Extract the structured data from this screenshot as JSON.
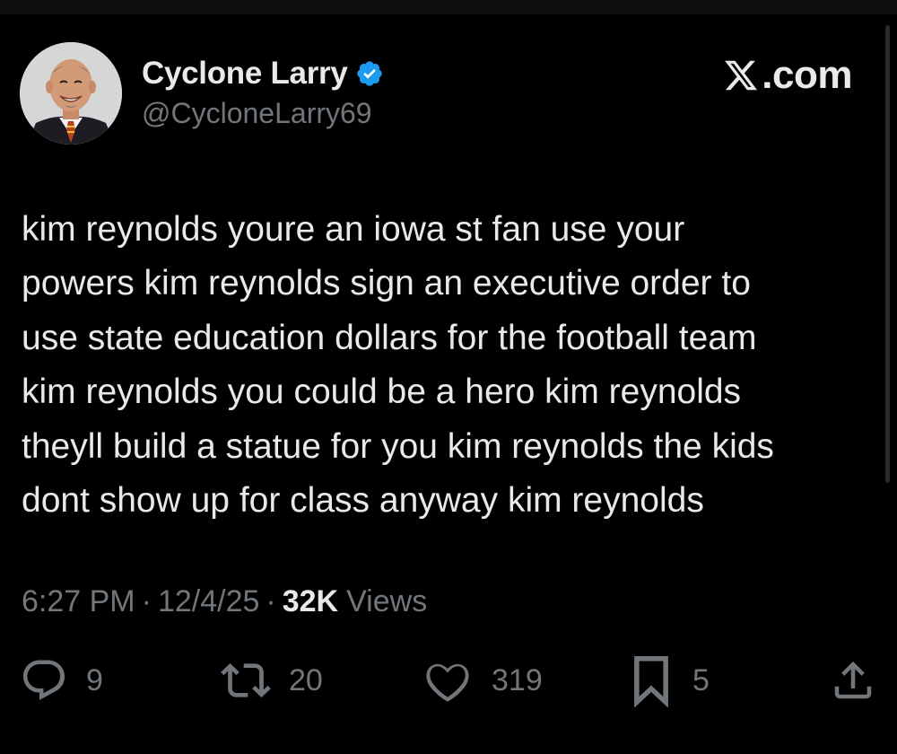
{
  "author": {
    "display_name": "Cyclone Larry",
    "handle": "@CycloneLarry69",
    "verified": true,
    "verified_color": "#1d9bf0"
  },
  "brand": {
    "text": ".com",
    "icon": "x-logo-icon"
  },
  "tweet": {
    "text": "kim reynolds youre an iowa st fan use your\npowers kim reynolds sign an executive order to\nuse state education dollars for the football team\nkim reynolds you could be a hero kim reynolds\ntheyll build a statue for you kim reynolds the kids\ndont show up for class anyway kim reynolds"
  },
  "meta": {
    "time": "6:27 PM",
    "separator": "·",
    "date": "12/4/25",
    "views_count": "32K",
    "views_label": "Views"
  },
  "actions": {
    "reply": {
      "icon": "reply-icon",
      "count": "9"
    },
    "repost": {
      "icon": "repost-icon",
      "count": "20"
    },
    "like": {
      "icon": "heart-icon",
      "count": "319"
    },
    "bookmark": {
      "icon": "bookmark-icon",
      "count": "5"
    },
    "share": {
      "icon": "share-icon"
    }
  },
  "colors": {
    "background": "#000000",
    "text_primary": "#e7e9ea",
    "text_secondary": "#71767b"
  }
}
